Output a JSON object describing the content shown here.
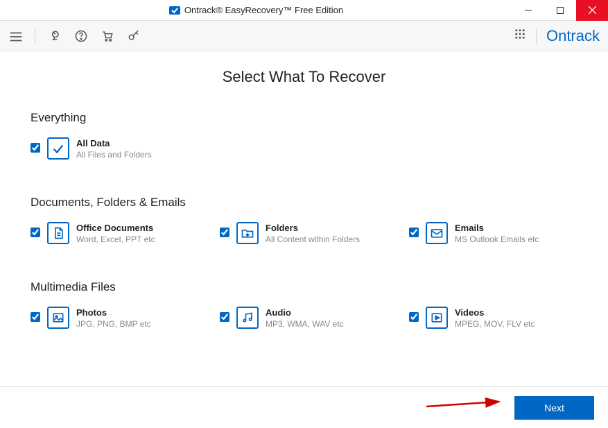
{
  "app": {
    "title": "Ontrack® EasyRecovery™ Free Edition",
    "brand": "Ontrack"
  },
  "page": {
    "title": "Select What To Recover"
  },
  "sections": {
    "everything": {
      "title": "Everything",
      "all_data": {
        "title": "All Data",
        "desc": "All Files and Folders"
      }
    },
    "documents": {
      "title": "Documents, Folders & Emails",
      "office": {
        "title": "Office Documents",
        "desc": "Word, Excel, PPT etc"
      },
      "folders": {
        "title": "Folders",
        "desc": "All Content within Folders"
      },
      "emails": {
        "title": "Emails",
        "desc": "MS Outlook Emails etc"
      }
    },
    "multimedia": {
      "title": "Multimedia Files",
      "photos": {
        "title": "Photos",
        "desc": "JPG, PNG, BMP etc"
      },
      "audio": {
        "title": "Audio",
        "desc": "MP3, WMA, WAV etc"
      },
      "videos": {
        "title": "Videos",
        "desc": "MPEG, MOV, FLV etc"
      }
    }
  },
  "footer": {
    "next": "Next"
  }
}
